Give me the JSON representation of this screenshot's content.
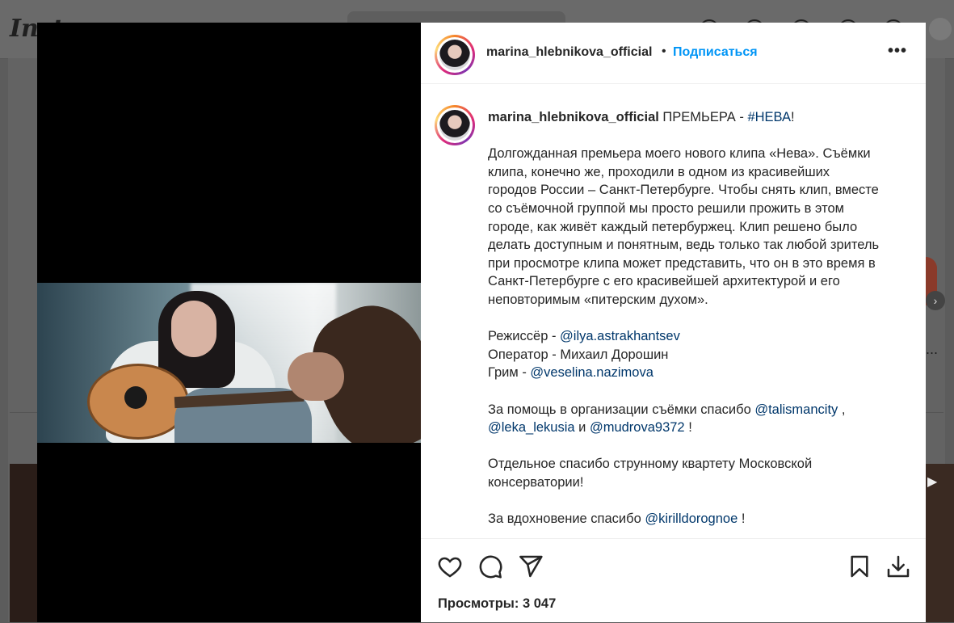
{
  "background": {
    "logo_text": "Insta",
    "more_glyph": "..."
  },
  "post": {
    "username": "marina_hlebnikova_official",
    "follow_label": "Подписаться",
    "more_label": "•••",
    "caption_title": "ПРЕМЬЕРА - ",
    "caption_hashtag": "#НЕВА",
    "caption_title_tail": "!",
    "paragraph1_lines": [
      "Долгожданная премьера моего нового клипа «Нева». Съёмки",
      "клипа, конечно же, проходили в одном из красивейших",
      "городов России – Санкт-Петербурге. Чтобы снять клип, вместе",
      "со съёмочной группой мы просто решили прожить в этом",
      "городе, как живёт каждый петербуржец. Клип решено было",
      "делать доступным и понятным, ведь только так любой зритель",
      "при просмотре клипа может представить, что он в это время в",
      "Санкт-Петербурге с его красивейшей архитектурой и его",
      "неповторимым «питерским духом»."
    ],
    "credits": {
      "director_label": "Режиссёр - ",
      "director_mention": "@ilya.astrakhantsev",
      "operator_text": "Оператор - Михаил Дорошин",
      "makeup_label": "Грим - ",
      "makeup_mention": "@veselina.nazimova"
    },
    "thanks": {
      "prefix": "За помощь в организации съёмки спасибо ",
      "mention1": "@talismancity",
      "sep1": " ,",
      "mention2": "@leka_lekusia",
      "and": " и ",
      "mention3": "@mudrova9372",
      "suffix": " !"
    },
    "quartet_lines": [
      "Отдельное спасибо струнному квартету Московской",
      "консерватории!"
    ],
    "inspiration": {
      "prefix": "За вдохновение спасибо ",
      "mention": "@kirilldorognoe",
      "suffix": " !"
    },
    "actions": {
      "like_icon": "heart-icon",
      "comment_icon": "comment-icon",
      "share_icon": "paper-plane-icon",
      "save_icon": "bookmark-icon",
      "download_icon": "download-icon"
    },
    "views_text": "Просмотры: 3 047"
  },
  "colors": {
    "link_blue": "#0095f6",
    "mention_blue": "#00376b",
    "text": "#262626"
  }
}
